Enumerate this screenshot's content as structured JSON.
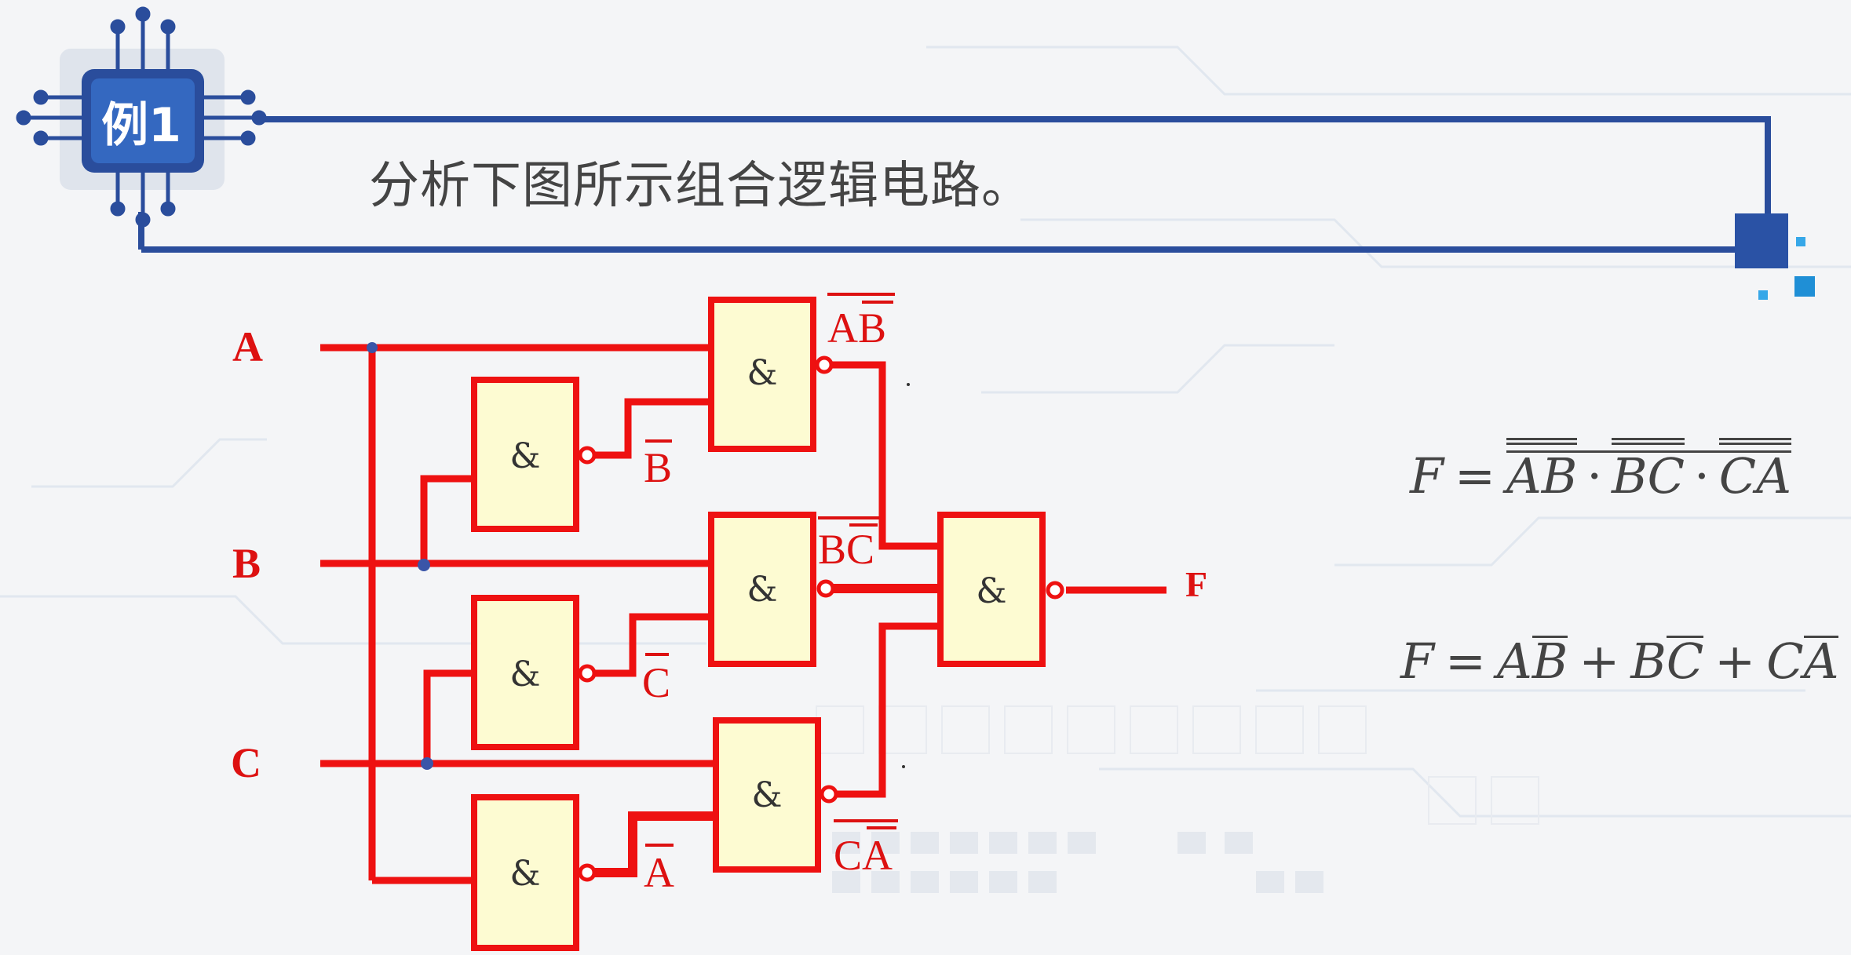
{
  "badge": {
    "label": "例1"
  },
  "prompt": {
    "text": "分析下图所示组合逻辑电路。"
  },
  "circuit": {
    "inputs": [
      "A",
      "B",
      "C"
    ],
    "output": "F",
    "gate_symbol": "&",
    "signal_labels": {
      "ab_bar": "AB",
      "bc_bar": "BC",
      "ca_bar": "CA",
      "b_bar": "B",
      "c_bar": "C",
      "a_bar": "A"
    }
  },
  "formulas": {
    "f1": {
      "lhs": "F",
      "eq": "=",
      "t1": [
        "A",
        "B"
      ],
      "t2": [
        "B",
        "C"
      ],
      "t3": [
        "C",
        "A"
      ],
      "dot": "·"
    },
    "f2": {
      "lhs": "F",
      "eq": "=",
      "t1": [
        "A",
        "B"
      ],
      "t2": [
        "B",
        "C"
      ],
      "t3": [
        "C",
        "A"
      ],
      "plus": "+"
    }
  },
  "colors": {
    "wire": "#ee1111",
    "gate_fill": "#fdfbd2",
    "frame": "#2a4d9c",
    "label": "#dd1111"
  }
}
